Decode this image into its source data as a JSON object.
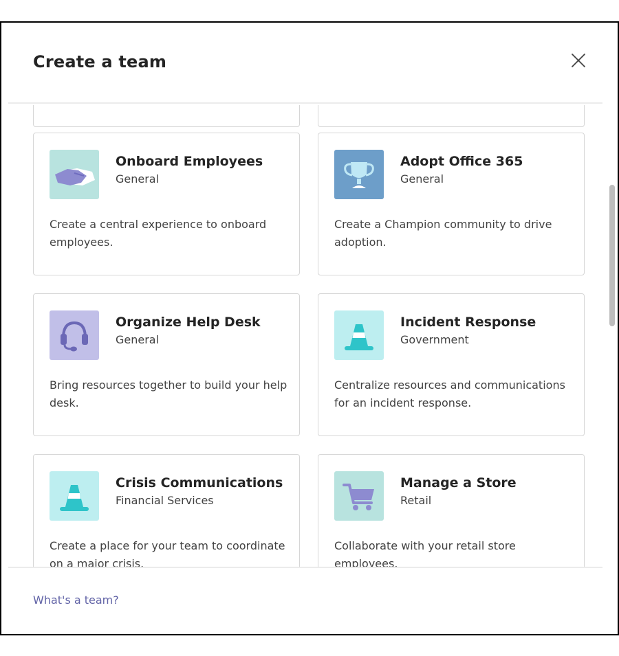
{
  "dialog": {
    "title": "Create a team",
    "close_icon": "close-icon",
    "footer_link": "What's a team?"
  },
  "templates": [
    {
      "name": "Onboard Employees",
      "category": "General",
      "description": "Create a central experience to onboard employees.",
      "icon": "handshake-icon",
      "icon_bg": "#b8e3df"
    },
    {
      "name": "Adopt Office 365",
      "category": "General",
      "description": "Create a Champion community to drive adoption.",
      "icon": "trophy-icon",
      "icon_bg": "#6d9ec9"
    },
    {
      "name": "Organize Help Desk",
      "category": "General",
      "description": "Bring resources together to build your help desk.",
      "icon": "headset-icon",
      "icon_bg": "#c1bfe8"
    },
    {
      "name": "Incident Response",
      "category": "Government",
      "description": "Centralize resources and communications for an incident response.",
      "icon": "traffic-cone-icon",
      "icon_bg": "#bdeef0"
    },
    {
      "name": "Crisis Communications",
      "category": "Financial Services",
      "description": "Create a place for your team to coordinate on a major crisis.",
      "icon": "traffic-cone-icon",
      "icon_bg": "#bdeef0"
    },
    {
      "name": "Manage a Store",
      "category": "Retail",
      "description": "Collaborate with your retail store employees.",
      "icon": "shopping-cart-icon",
      "icon_bg": "#b8e3df"
    }
  ],
  "colors": {
    "accent": "#6264a7",
    "card_border": "#d6d6d6"
  }
}
